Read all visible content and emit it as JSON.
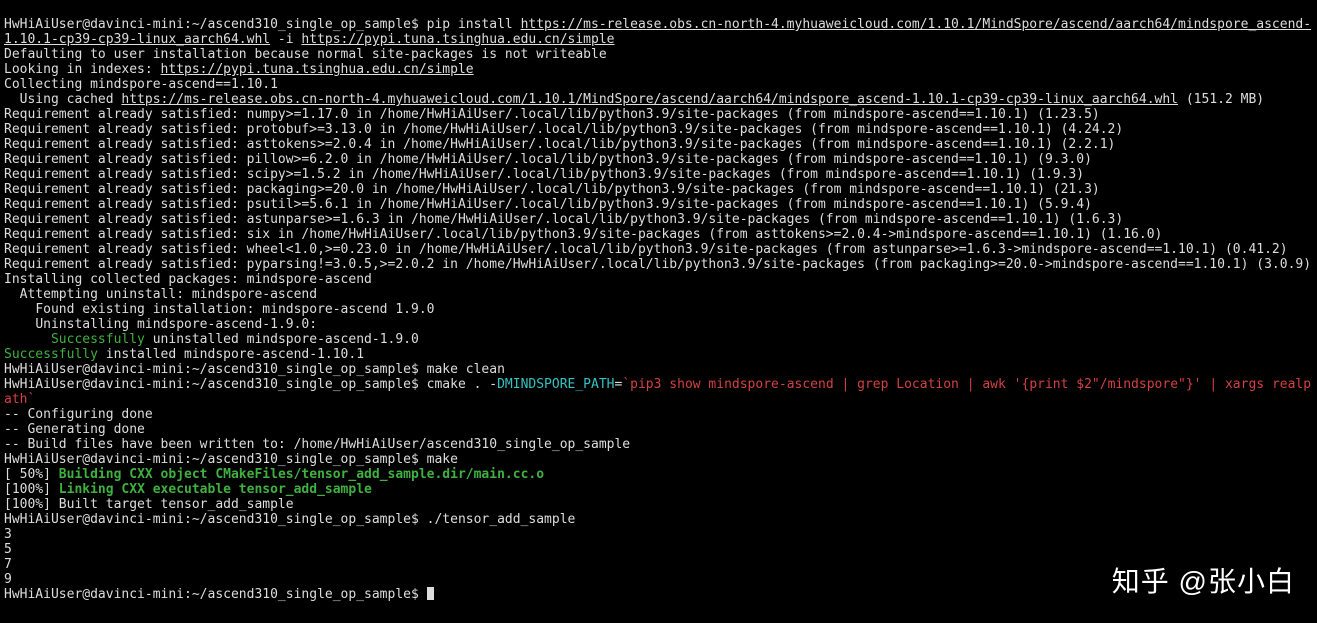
{
  "prompt": {
    "user": "HwHiAiUser",
    "host": "davinci-mini",
    "path": "~/ascend310_single_op_sample",
    "symbol": "$"
  },
  "cmds": {
    "pip_install_pre": "pip install ",
    "pip_install_url": "https://ms-release.obs.cn-north-4.myhuaweicloud.com/1.10.1/MindSpore/ascend/aarch64/mindspore_ascend-1.10.1-cp39-cp39-linux_aarch64.whl",
    "pip_install_flag": " -i ",
    "pip_install_index": "https://pypi.tuna.tsinghua.edu.cn/simple",
    "make_clean": "make clean",
    "cmake_pre": "cmake . -",
    "cmake_def": "DMINDSPORE_PATH",
    "cmake_eq": "=",
    "cmake_val": "`pip3 show mindspore-ascend | grep Location | awk '{print $2\"/mindspore\"}' | xargs realpath`",
    "make": "make",
    "run": "./tensor_add_sample"
  },
  "pip": {
    "defaulting": "Defaulting to user installation because normal site-packages is not writeable",
    "looking": "Looking in indexes: ",
    "index_link": "https://pypi.tuna.tsinghua.edu.cn/simple",
    "collecting": "Collecting mindspore-ascend==1.10.1",
    "usingcached": "  Using cached ",
    "cached_link": "https://ms-release.obs.cn-north-4.myhuaweicloud.com/1.10.1/MindSpore/ascend/aarch64/mindspore_ascend-1.10.1-cp39-cp39-linux_aarch64.whl",
    "cached_size": " (151.2 MB)",
    "reqs": [
      "Requirement already satisfied: numpy>=1.17.0 in /home/HwHiAiUser/.local/lib/python3.9/site-packages (from mindspore-ascend==1.10.1) (1.23.5)",
      "Requirement already satisfied: protobuf>=3.13.0 in /home/HwHiAiUser/.local/lib/python3.9/site-packages (from mindspore-ascend==1.10.1) (4.24.2)",
      "Requirement already satisfied: asttokens>=2.0.4 in /home/HwHiAiUser/.local/lib/python3.9/site-packages (from mindspore-ascend==1.10.1) (2.2.1)",
      "Requirement already satisfied: pillow>=6.2.0 in /home/HwHiAiUser/.local/lib/python3.9/site-packages (from mindspore-ascend==1.10.1) (9.3.0)",
      "Requirement already satisfied: scipy>=1.5.2 in /home/HwHiAiUser/.local/lib/python3.9/site-packages (from mindspore-ascend==1.10.1) (1.9.3)",
      "Requirement already satisfied: packaging>=20.0 in /home/HwHiAiUser/.local/lib/python3.9/site-packages (from mindspore-ascend==1.10.1) (21.3)",
      "Requirement already satisfied: psutil>=5.6.1 in /home/HwHiAiUser/.local/lib/python3.9/site-packages (from mindspore-ascend==1.10.1) (5.9.4)",
      "Requirement already satisfied: astunparse>=1.6.3 in /home/HwHiAiUser/.local/lib/python3.9/site-packages (from mindspore-ascend==1.10.1) (1.6.3)",
      "Requirement already satisfied: six in /home/HwHiAiUser/.local/lib/python3.9/site-packages (from asttokens>=2.0.4->mindspore-ascend==1.10.1) (1.16.0)",
      "Requirement already satisfied: wheel<1.0,>=0.23.0 in /home/HwHiAiUser/.local/lib/python3.9/site-packages (from astunparse>=1.6.3->mindspore-ascend==1.10.1) (0.41.2)",
      "Requirement already satisfied: pyparsing!=3.0.5,>=2.0.2 in /home/HwHiAiUser/.local/lib/python3.9/site-packages (from packaging>=20.0->mindspore-ascend==1.10.1) (3.0.9)"
    ],
    "installing": "Installing collected packages: mindspore-ascend",
    "attempt": "  Attempting uninstall: mindspore-ascend",
    "found": "    Found existing installation: mindspore-ascend 1.9.0",
    "uninst": "    Uninstalling mindspore-ascend-1.9.0:",
    "indent6": "      ",
    "succ1": "Successfully",
    "succ1_rest": " uninstalled mindspore-ascend-1.9.0",
    "succ2": "Successfully",
    "succ2_rest": " installed mindspore-ascend-1.10.1"
  },
  "cmake_out": {
    "conf": "-- Configuring done",
    "gen": "-- Generating done",
    "written": "-- Build files have been written to: /home/HwHiAiUser/ascend310_single_op_sample"
  },
  "make_out": {
    "p50_pre": "[ 50%] ",
    "p50_msg": "Building CXX object CMakeFiles/tensor_add_sample.dir/main.cc.o",
    "p100a_pre": "[100%] ",
    "p100a_msg": "Linking CXX executable tensor_add_sample",
    "p100b": "[100%] Built target tensor_add_sample"
  },
  "out": {
    "l1": "3",
    "l2": "5",
    "l3": "7",
    "l4": "9"
  },
  "watermark1": "知乎",
  "watermark2": " @张小白"
}
